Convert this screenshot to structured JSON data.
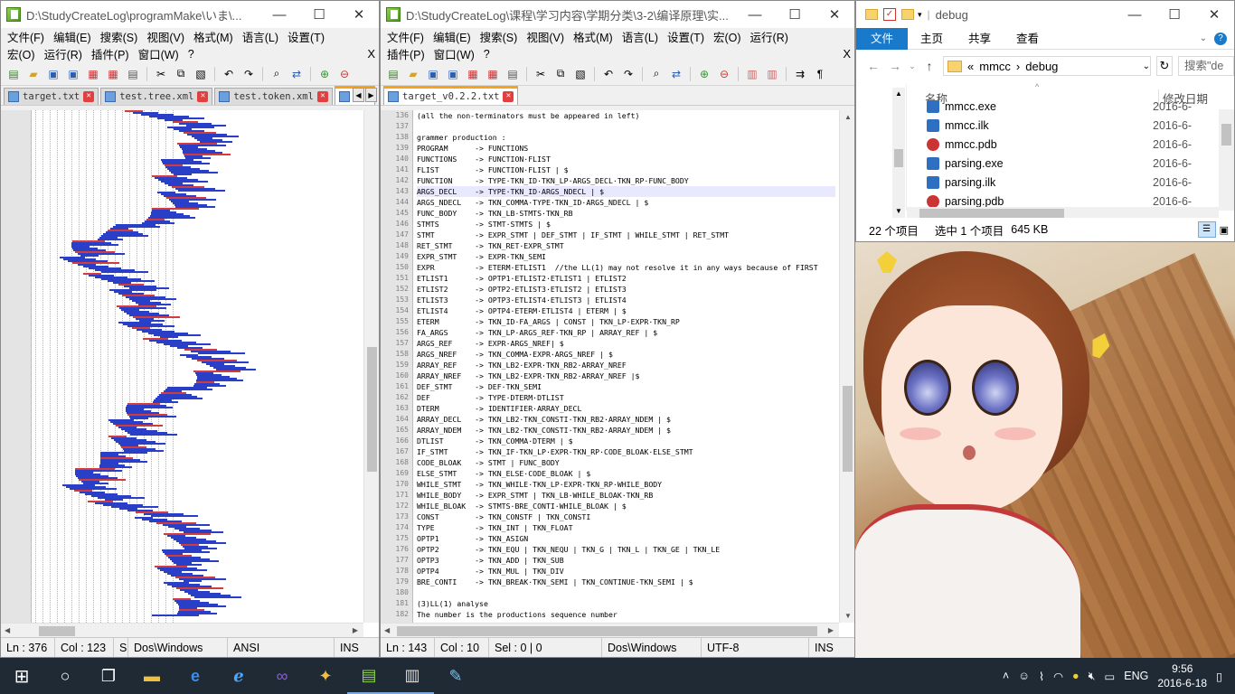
{
  "left_window": {
    "title": "D:\\StudyCreateLog\\programMake\\いま\\...",
    "menu": [
      "文件(F)",
      "编辑(E)",
      "搜索(S)",
      "视图(V)",
      "格式(M)",
      "语言(L)",
      "设置(T)"
    ],
    "menu2": [
      "宏(O)",
      "运行(R)",
      "插件(P)",
      "窗口(W)",
      "?"
    ],
    "menu_close": "X",
    "tabs": [
      "target.txt",
      "test.tree.xml",
      "test.token.xml",
      "tes"
    ],
    "status": {
      "ln": "Ln : 376",
      "col": "Col : 123",
      "s": "S",
      "eol": "Dos\\Windows",
      "enc": "ANSI",
      "ins": "INS"
    }
  },
  "mid_window": {
    "title": "D:\\StudyCreateLog\\课程\\学习内容\\学期分类\\3-2\\编译原理\\实...",
    "menu": [
      "文件(F)",
      "编辑(E)",
      "搜索(S)",
      "视图(V)",
      "格式(M)",
      "语言(L)",
      "设置(T)",
      "宏(O)",
      "运行(R)"
    ],
    "menu2": [
      "插件(P)",
      "窗口(W)",
      "?"
    ],
    "menu_close": "X",
    "tab": "target_v0.2.2.txt",
    "status": {
      "ln": "Ln : 143",
      "col": "Col : 10",
      "sel": "Sel : 0 | 0",
      "eol": "Dos\\Windows",
      "enc": "UTF-8",
      "ins": "INS"
    },
    "code": [
      {
        "n": "136",
        "t": "(all the non-terminators must be appeared in left)"
      },
      {
        "n": "137",
        "t": ""
      },
      {
        "n": "138",
        "t": "grammer production :"
      },
      {
        "n": "139",
        "t": "PROGRAM      -> FUNCTIONS"
      },
      {
        "n": "140",
        "t": "FUNCTIONS    -> FUNCTION·FLIST"
      },
      {
        "n": "141",
        "t": "FLIST        -> FUNCTION·FLIST | $"
      },
      {
        "n": "142",
        "t": "FUNCTION     -> TYPE·TKN_ID·TKN_LP·ARGS_DECL·TKN_RP·FUNC_BODY"
      },
      {
        "n": "143",
        "t": "ARGS_DECL    -> TYPE·TKN_ID·ARGS_NDECL | $"
      },
      {
        "n": "144",
        "t": "ARGS_NDECL   -> TKN_COMMA·TYPE·TKN_ID·ARGS_NDECL | $"
      },
      {
        "n": "145",
        "t": "FUNC_BODY    -> TKN_LB·STMTS·TKN_RB"
      },
      {
        "n": "146",
        "t": "STMTS        -> STMT·STMTS | $"
      },
      {
        "n": "147",
        "t": "STMT         -> EXPR_STMT | DEF_STMT | IF_STMT | WHILE_STMT | RET_STMT"
      },
      {
        "n": "148",
        "t": "RET_STMT     -> TKN_RET·EXPR_STMT"
      },
      {
        "n": "149",
        "t": "EXPR_STMT    -> EXPR·TKN_SEMI"
      },
      {
        "n": "150",
        "t": "EXPR         -> ETERM·ETLIST1  //the LL(1) may not resolve it in any ways because of FIRST"
      },
      {
        "n": "151",
        "t": "ETLIST1      -> OPTP1·ETLIST2·ETLIST1 | ETLIST2"
      },
      {
        "n": "152",
        "t": "ETLIST2      -> OPTP2·ETLIST3·ETLIST2 | ETLIST3"
      },
      {
        "n": "153",
        "t": "ETLIST3      -> OPTP3·ETLIST4·ETLIST3 | ETLIST4"
      },
      {
        "n": "154",
        "t": "ETLIST4      -> OPTP4·ETERM·ETLIST4 | ETERM | $"
      },
      {
        "n": "155",
        "t": "ETERM        -> TKN_ID·FA_ARGS | CONST | TKN_LP·EXPR·TKN_RP"
      },
      {
        "n": "156",
        "t": "FA_ARGS      -> TKN_LP·ARGS_REF·TKN_RP | ARRAY_REF | $"
      },
      {
        "n": "157",
        "t": "ARGS_REF     -> EXPR·ARGS_NREF| $"
      },
      {
        "n": "158",
        "t": "ARGS_NREF    -> TKN_COMMA·EXPR·ARGS_NREF | $"
      },
      {
        "n": "159",
        "t": "ARRAY_REF    -> TKN_LB2·EXPR·TKN_RB2·ARRAY_NREF"
      },
      {
        "n": "160",
        "t": "ARRAY_NREF   -> TKN_LB2·EXPR·TKN_RB2·ARRAY_NREF |$"
      },
      {
        "n": "161",
        "t": "DEF_STMT     -> DEF·TKN_SEMI"
      },
      {
        "n": "162",
        "t": "DEF          -> TYPE·DTERM·DTLIST"
      },
      {
        "n": "163",
        "t": "DTERM        -> IDENTIFIER·ARRAY_DECL"
      },
      {
        "n": "164",
        "t": "ARRAY_DECL   -> TKN_LB2·TKN_CONSTI·TKN_RB2·ARRAY_NDEM | $"
      },
      {
        "n": "165",
        "t": "ARRAY_NDEM   -> TKN_LB2·TKN_CONSTI·TKN_RB2·ARRAY_NDEM | $"
      },
      {
        "n": "166",
        "t": "DTLIST       -> TKN_COMMA·DTERM | $"
      },
      {
        "n": "167",
        "t": "IF_STMT      -> TKN_IF·TKN_LP·EXPR·TKN_RP·CODE_BLOAK·ELSE_STMT"
      },
      {
        "n": "168",
        "t": "CODE_BLOAK   -> STMT | FUNC_BODY"
      },
      {
        "n": "169",
        "t": "ELSE_STMT    -> TKN_ELSE·CODE_BLOAK | $"
      },
      {
        "n": "170",
        "t": "WHILE_STMT   -> TKN_WHILE·TKN_LP·EXPR·TKN_RP·WHILE_BODY"
      },
      {
        "n": "171",
        "t": "WHILE_BODY   -> EXPR_STMT | TKN_LB·WHILE_BLOAK·TKN_RB"
      },
      {
        "n": "172",
        "t": "WHILE_BLOAK  -> STMTS·BRE_CONTI·WHILE_BLOAK | $"
      },
      {
        "n": "173",
        "t": "CONST        -> TKN_CONSTF | TKN_CONSTI"
      },
      {
        "n": "174",
        "t": "TYPE         -> TKN_INT | TKN_FLOAT"
      },
      {
        "n": "175",
        "t": "OPTP1        -> TKN_ASIGN"
      },
      {
        "n": "176",
        "t": "OPTP2        -> TKN_EQU | TKN_NEQU | TKN_G | TKN_L | TKN_GE | TKN_LE"
      },
      {
        "n": "177",
        "t": "OPTP3        -> TKN_ADD | TKN_SUB"
      },
      {
        "n": "178",
        "t": "OPTP4        -> TKN_MUL | TKN_DIV"
      },
      {
        "n": "179",
        "t": "BRE_CONTI    -> TKN_BREAK·TKN_SEMI | TKN_CONTINUE·TKN_SEMI | $"
      },
      {
        "n": "180",
        "t": ""
      },
      {
        "n": "181",
        "t": "(3)LL(1) analyse"
      },
      {
        "n": "182",
        "t": "The number is the productions sequence number"
      }
    ]
  },
  "explorer": {
    "title": "debug",
    "ribbon": [
      "文件",
      "主页",
      "共享",
      "查看"
    ],
    "path": [
      "«",
      "mmcc",
      "›",
      "debug"
    ],
    "search_placeholder": "搜索\"de",
    "col_name": "名称",
    "col_date": "修改日期",
    "files": [
      {
        "name": "mmcc.exe",
        "date": "2016-6-"
      },
      {
        "name": "mmcc.ilk",
        "date": "2016-6-"
      },
      {
        "name": "mmcc.pdb",
        "date": "2016-6-"
      },
      {
        "name": "parsing.exe",
        "date": "2016-6-"
      },
      {
        "name": "parsing.ilk",
        "date": "2016-6-"
      },
      {
        "name": "parsing.pdb",
        "date": "2016-6-"
      }
    ],
    "status": {
      "count": "22 个项目",
      "selected": "选中 1 个项目",
      "size": "645 KB"
    }
  },
  "taskbar": {
    "lang": "ENG",
    "time": "9:56",
    "date": "2016-6-18"
  },
  "colors": {
    "accent": "#1979ca",
    "taskbar": "#1f2a35",
    "tab_active": "#f7a21a"
  }
}
